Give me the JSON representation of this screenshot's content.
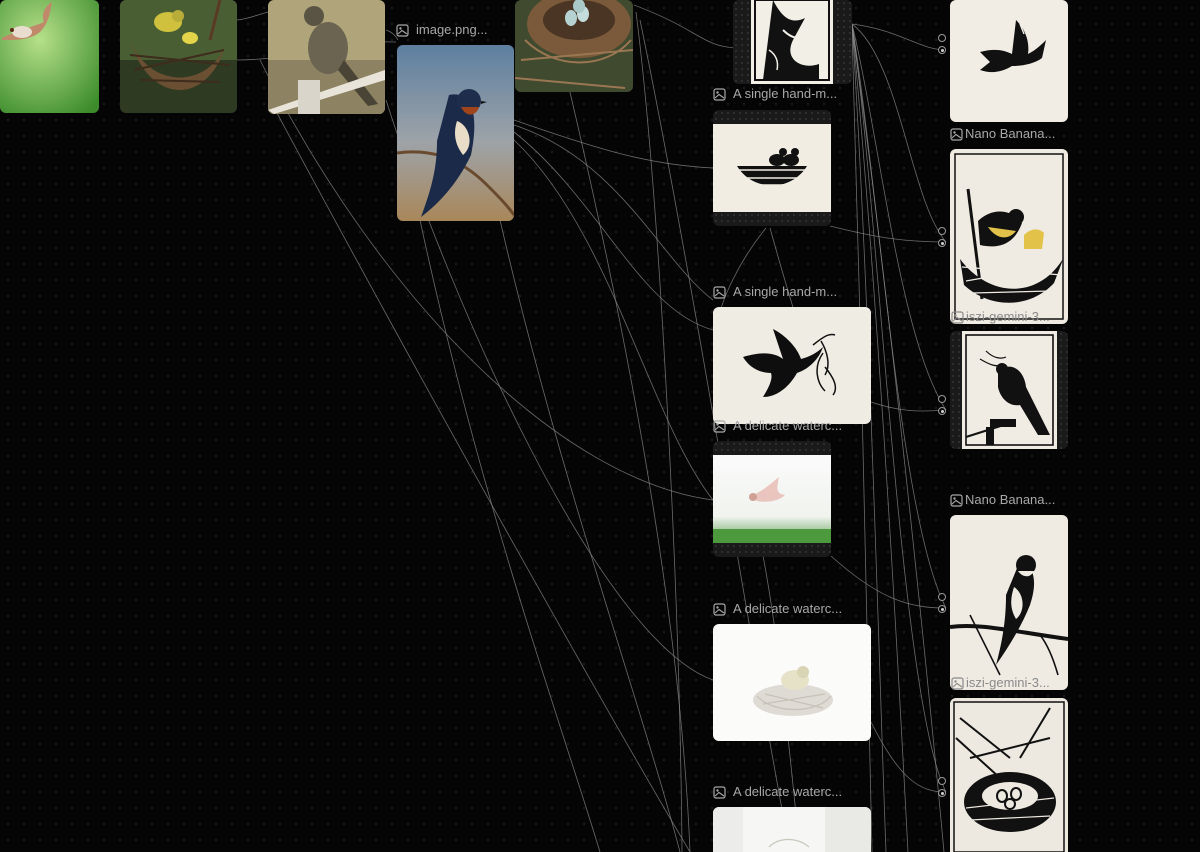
{
  "canvas": {
    "labels": {
      "image_png": "image.png...",
      "single_hand_1": "A single hand-m...",
      "single_hand_2": "A single hand-m...",
      "delicate_1": "A delicate waterc...",
      "delicate_2": "A delicate waterc...",
      "delicate_3": "A delicate waterc...",
      "nano_banana_1": "Nano Banana...",
      "nano_banana_2": "Nano Banana...",
      "iszi_gemini_1": "iszi-gemini-3...",
      "iszi_gemini_2": "iszi-gemini-3..."
    },
    "icons": {
      "image_node": "image-icon"
    },
    "colors": {
      "background": "#050505",
      "wire": "#8a8a8a",
      "label": "#a8a8a8"
    }
  }
}
